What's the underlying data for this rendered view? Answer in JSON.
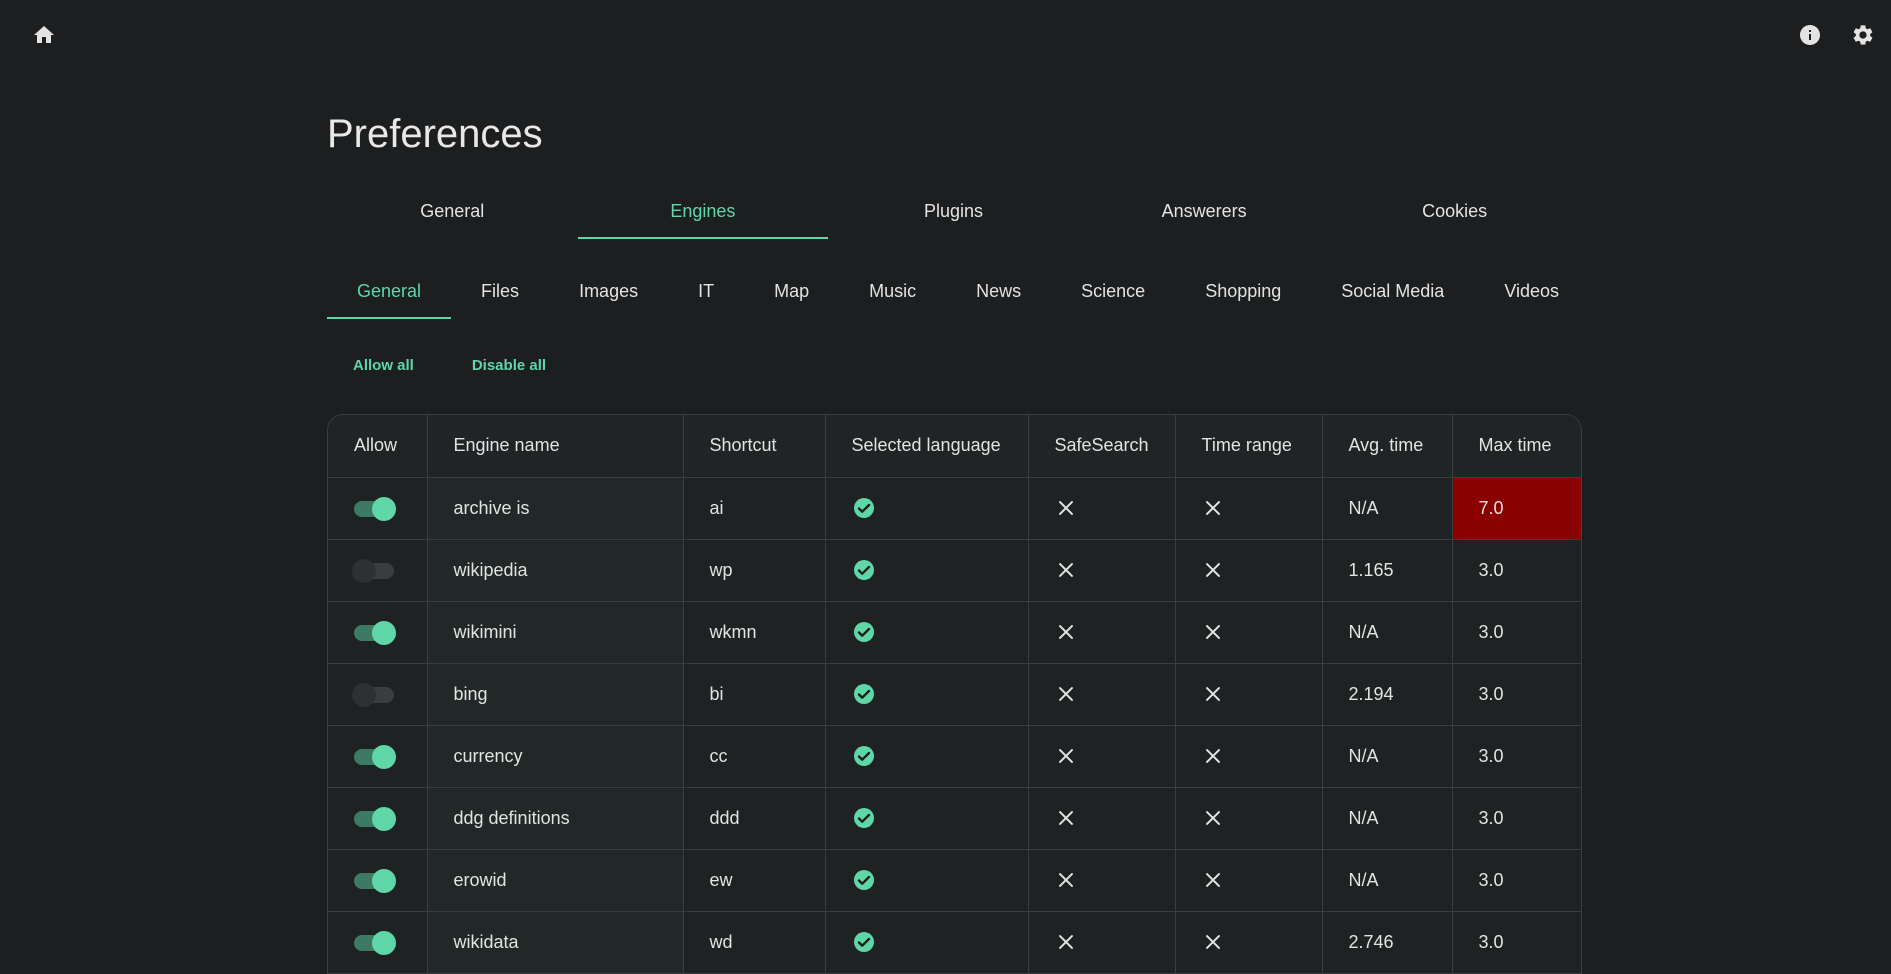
{
  "topbar": {
    "home_icon": "home-icon",
    "info_icon": "info-icon",
    "settings_icon": "gear-icon"
  },
  "page_title": "Preferences",
  "main_tabs": [
    {
      "label": "General",
      "active": false
    },
    {
      "label": "Engines",
      "active": true
    },
    {
      "label": "Plugins",
      "active": false
    },
    {
      "label": "Answerers",
      "active": false
    },
    {
      "label": "Cookies",
      "active": false
    }
  ],
  "sub_tabs": [
    {
      "label": "General",
      "active": true
    },
    {
      "label": "Files",
      "active": false
    },
    {
      "label": "Images",
      "active": false
    },
    {
      "label": "IT",
      "active": false
    },
    {
      "label": "Map",
      "active": false
    },
    {
      "label": "Music",
      "active": false
    },
    {
      "label": "News",
      "active": false
    },
    {
      "label": "Science",
      "active": false
    },
    {
      "label": "Shopping",
      "active": false
    },
    {
      "label": "Social Media",
      "active": false
    },
    {
      "label": "Videos",
      "active": false
    }
  ],
  "actions": {
    "allow_all": "Allow all",
    "disable_all": "Disable all"
  },
  "table": {
    "headers": [
      "Allow",
      "Engine name",
      "Shortcut",
      "Selected language",
      "SafeSearch",
      "Time range",
      "Avg. time",
      "Max time"
    ],
    "rows": [
      {
        "allow": true,
        "name": "archive is",
        "shortcut": "ai",
        "language": true,
        "safesearch": false,
        "time_range": false,
        "avg_time": "N/A",
        "max_time": "7.0",
        "max_warn": true
      },
      {
        "allow": false,
        "name": "wikipedia",
        "shortcut": "wp",
        "language": true,
        "safesearch": false,
        "time_range": false,
        "avg_time": "1.165",
        "max_time": "3.0",
        "max_warn": false
      },
      {
        "allow": true,
        "name": "wikimini",
        "shortcut": "wkmn",
        "language": true,
        "safesearch": false,
        "time_range": false,
        "avg_time": "N/A",
        "max_time": "3.0",
        "max_warn": false
      },
      {
        "allow": false,
        "name": "bing",
        "shortcut": "bi",
        "language": true,
        "safesearch": false,
        "time_range": false,
        "avg_time": "2.194",
        "max_time": "3.0",
        "max_warn": false
      },
      {
        "allow": true,
        "name": "currency",
        "shortcut": "cc",
        "language": true,
        "safesearch": false,
        "time_range": false,
        "avg_time": "N/A",
        "max_time": "3.0",
        "max_warn": false
      },
      {
        "allow": true,
        "name": "ddg definitions",
        "shortcut": "ddd",
        "language": true,
        "safesearch": false,
        "time_range": false,
        "avg_time": "N/A",
        "max_time": "3.0",
        "max_warn": false
      },
      {
        "allow": true,
        "name": "erowid",
        "shortcut": "ew",
        "language": true,
        "safesearch": false,
        "time_range": false,
        "avg_time": "N/A",
        "max_time": "3.0",
        "max_warn": false
      },
      {
        "allow": true,
        "name": "wikidata",
        "shortcut": "wd",
        "language": true,
        "safesearch": false,
        "time_range": false,
        "avg_time": "2.746",
        "max_time": "3.0",
        "max_warn": false
      }
    ]
  },
  "colors": {
    "accent": "#5ed6a8",
    "background": "#1c1e1f",
    "danger": "#8b0000"
  }
}
